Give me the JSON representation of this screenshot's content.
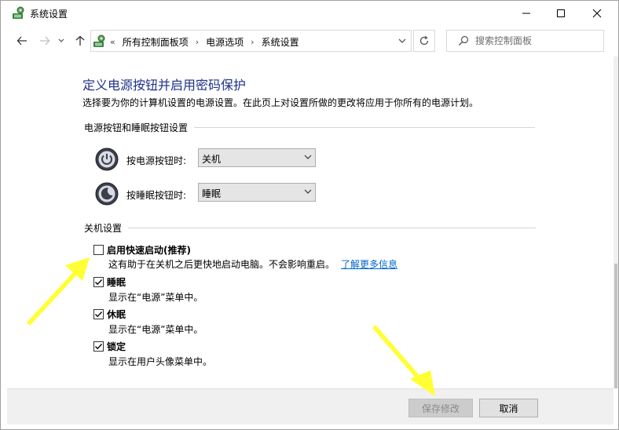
{
  "window": {
    "title": "系统设置",
    "controls": {
      "minimize": "—",
      "maximize": "☐",
      "close": "✕"
    }
  },
  "address_bar": {
    "overflow": "«",
    "breadcrumb": [
      "所有控制面板项",
      "电源选项",
      "系统设置"
    ],
    "separator": "›",
    "search_placeholder": "搜索控制面板"
  },
  "page": {
    "title": "定义电源按钮并启用密码保护",
    "description": "选择要为你的计算机设置的电源设置。在此页上对设置所做的更改将应用于你所有的电源计划。"
  },
  "power_buttons": {
    "section_title": "电源按钮和睡眠按钮设置",
    "power_label": "按电源按钮时:",
    "power_value": "关机",
    "sleep_label": "按睡眠按钮时:",
    "sleep_value": "睡眠"
  },
  "shutdown": {
    "section_title": "关机设置",
    "options": [
      {
        "label": "启用快速启动(推荐)",
        "checked": false,
        "description": "这有助于在关机之后更快地启动电脑。不会影响重启。",
        "link": "了解更多信息"
      },
      {
        "label": "睡眠",
        "checked": true,
        "description": "显示在“电源”菜单中。"
      },
      {
        "label": "休眠",
        "checked": true,
        "description": "显示在“电源”菜单中。"
      },
      {
        "label": "锁定",
        "checked": true,
        "description": "显示在用户头像菜单中。"
      }
    ]
  },
  "footer": {
    "save_label": "保存修改",
    "cancel_label": "取消"
  },
  "colors": {
    "title_blue": "#1e3287",
    "link_blue": "#0066cc",
    "annotation_yellow": "#ffff33"
  }
}
